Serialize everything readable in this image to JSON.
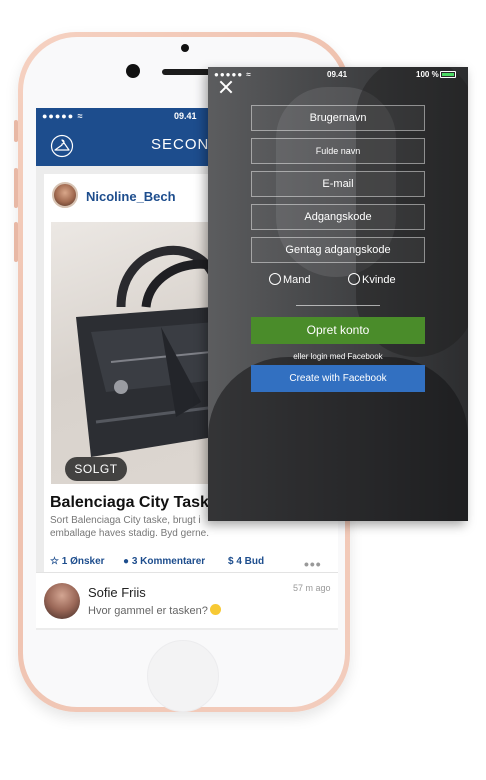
{
  "base_screen": {
    "status": {
      "signal": "●●●●● ≈",
      "time": "09.41"
    },
    "nav": {
      "title": "SECOND",
      "logo_icon": "hanger-logo-icon"
    },
    "post": {
      "username": "Nicoline_Bech",
      "sold_badge": "SOLGT",
      "title": "Balenciaga City Taske",
      "description": "Sort Balenciaga City taske, brugt i emballage haves stadig. Byd gerne.",
      "wishes": "1 Ønsker",
      "comments": "3 Kommentarer",
      "bids": "$ 4 Bud",
      "more": "•••"
    },
    "comment": {
      "name": "Sofie Friis",
      "time": "57 m ago",
      "text": "Hvor gammel er tasken?"
    }
  },
  "signup": {
    "status": {
      "signal": "●●●●● ≈",
      "time": "09.41",
      "battery": "100 %"
    },
    "fields": {
      "username": "Brugernavn",
      "fullname": "Fulde navn",
      "email": "E-mail",
      "password": "Adgangskode",
      "repeat_password": "Gentag adgangskode"
    },
    "gender": {
      "male": "Mand",
      "female": "Kvinde"
    },
    "create_button": "Opret konto",
    "or_text": "eller login med Facebook",
    "facebook_button": "Create with Facebook"
  },
  "colors": {
    "brand_blue": "#1d4d8d",
    "create_green": "#4a8c2a",
    "facebook_blue": "#3270c1",
    "phone_frame": "#f3cdbd"
  }
}
